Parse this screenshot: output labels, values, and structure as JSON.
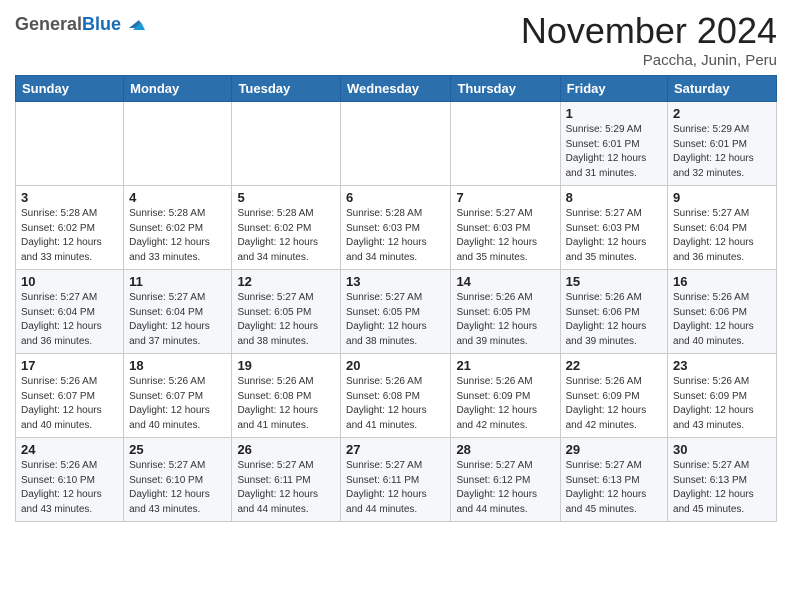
{
  "header": {
    "logo_general": "General",
    "logo_blue": "Blue",
    "month_title": "November 2024",
    "subtitle": "Paccha, Junin, Peru"
  },
  "days_of_week": [
    "Sunday",
    "Monday",
    "Tuesday",
    "Wednesday",
    "Thursday",
    "Friday",
    "Saturday"
  ],
  "weeks": [
    [
      {
        "day": "",
        "info": ""
      },
      {
        "day": "",
        "info": ""
      },
      {
        "day": "",
        "info": ""
      },
      {
        "day": "",
        "info": ""
      },
      {
        "day": "",
        "info": ""
      },
      {
        "day": "1",
        "info": "Sunrise: 5:29 AM\nSunset: 6:01 PM\nDaylight: 12 hours\nand 31 minutes."
      },
      {
        "day": "2",
        "info": "Sunrise: 5:29 AM\nSunset: 6:01 PM\nDaylight: 12 hours\nand 32 minutes."
      }
    ],
    [
      {
        "day": "3",
        "info": "Sunrise: 5:28 AM\nSunset: 6:02 PM\nDaylight: 12 hours\nand 33 minutes."
      },
      {
        "day": "4",
        "info": "Sunrise: 5:28 AM\nSunset: 6:02 PM\nDaylight: 12 hours\nand 33 minutes."
      },
      {
        "day": "5",
        "info": "Sunrise: 5:28 AM\nSunset: 6:02 PM\nDaylight: 12 hours\nand 34 minutes."
      },
      {
        "day": "6",
        "info": "Sunrise: 5:28 AM\nSunset: 6:03 PM\nDaylight: 12 hours\nand 34 minutes."
      },
      {
        "day": "7",
        "info": "Sunrise: 5:27 AM\nSunset: 6:03 PM\nDaylight: 12 hours\nand 35 minutes."
      },
      {
        "day": "8",
        "info": "Sunrise: 5:27 AM\nSunset: 6:03 PM\nDaylight: 12 hours\nand 35 minutes."
      },
      {
        "day": "9",
        "info": "Sunrise: 5:27 AM\nSunset: 6:04 PM\nDaylight: 12 hours\nand 36 minutes."
      }
    ],
    [
      {
        "day": "10",
        "info": "Sunrise: 5:27 AM\nSunset: 6:04 PM\nDaylight: 12 hours\nand 36 minutes."
      },
      {
        "day": "11",
        "info": "Sunrise: 5:27 AM\nSunset: 6:04 PM\nDaylight: 12 hours\nand 37 minutes."
      },
      {
        "day": "12",
        "info": "Sunrise: 5:27 AM\nSunset: 6:05 PM\nDaylight: 12 hours\nand 38 minutes."
      },
      {
        "day": "13",
        "info": "Sunrise: 5:27 AM\nSunset: 6:05 PM\nDaylight: 12 hours\nand 38 minutes."
      },
      {
        "day": "14",
        "info": "Sunrise: 5:26 AM\nSunset: 6:05 PM\nDaylight: 12 hours\nand 39 minutes."
      },
      {
        "day": "15",
        "info": "Sunrise: 5:26 AM\nSunset: 6:06 PM\nDaylight: 12 hours\nand 39 minutes."
      },
      {
        "day": "16",
        "info": "Sunrise: 5:26 AM\nSunset: 6:06 PM\nDaylight: 12 hours\nand 40 minutes."
      }
    ],
    [
      {
        "day": "17",
        "info": "Sunrise: 5:26 AM\nSunset: 6:07 PM\nDaylight: 12 hours\nand 40 minutes."
      },
      {
        "day": "18",
        "info": "Sunrise: 5:26 AM\nSunset: 6:07 PM\nDaylight: 12 hours\nand 40 minutes."
      },
      {
        "day": "19",
        "info": "Sunrise: 5:26 AM\nSunset: 6:08 PM\nDaylight: 12 hours\nand 41 minutes."
      },
      {
        "day": "20",
        "info": "Sunrise: 5:26 AM\nSunset: 6:08 PM\nDaylight: 12 hours\nand 41 minutes."
      },
      {
        "day": "21",
        "info": "Sunrise: 5:26 AM\nSunset: 6:09 PM\nDaylight: 12 hours\nand 42 minutes."
      },
      {
        "day": "22",
        "info": "Sunrise: 5:26 AM\nSunset: 6:09 PM\nDaylight: 12 hours\nand 42 minutes."
      },
      {
        "day": "23",
        "info": "Sunrise: 5:26 AM\nSunset: 6:09 PM\nDaylight: 12 hours\nand 43 minutes."
      }
    ],
    [
      {
        "day": "24",
        "info": "Sunrise: 5:26 AM\nSunset: 6:10 PM\nDaylight: 12 hours\nand 43 minutes."
      },
      {
        "day": "25",
        "info": "Sunrise: 5:27 AM\nSunset: 6:10 PM\nDaylight: 12 hours\nand 43 minutes."
      },
      {
        "day": "26",
        "info": "Sunrise: 5:27 AM\nSunset: 6:11 PM\nDaylight: 12 hours\nand 44 minutes."
      },
      {
        "day": "27",
        "info": "Sunrise: 5:27 AM\nSunset: 6:11 PM\nDaylight: 12 hours\nand 44 minutes."
      },
      {
        "day": "28",
        "info": "Sunrise: 5:27 AM\nSunset: 6:12 PM\nDaylight: 12 hours\nand 44 minutes."
      },
      {
        "day": "29",
        "info": "Sunrise: 5:27 AM\nSunset: 6:13 PM\nDaylight: 12 hours\nand 45 minutes."
      },
      {
        "day": "30",
        "info": "Sunrise: 5:27 AM\nSunset: 6:13 PM\nDaylight: 12 hours\nand 45 minutes."
      }
    ]
  ]
}
